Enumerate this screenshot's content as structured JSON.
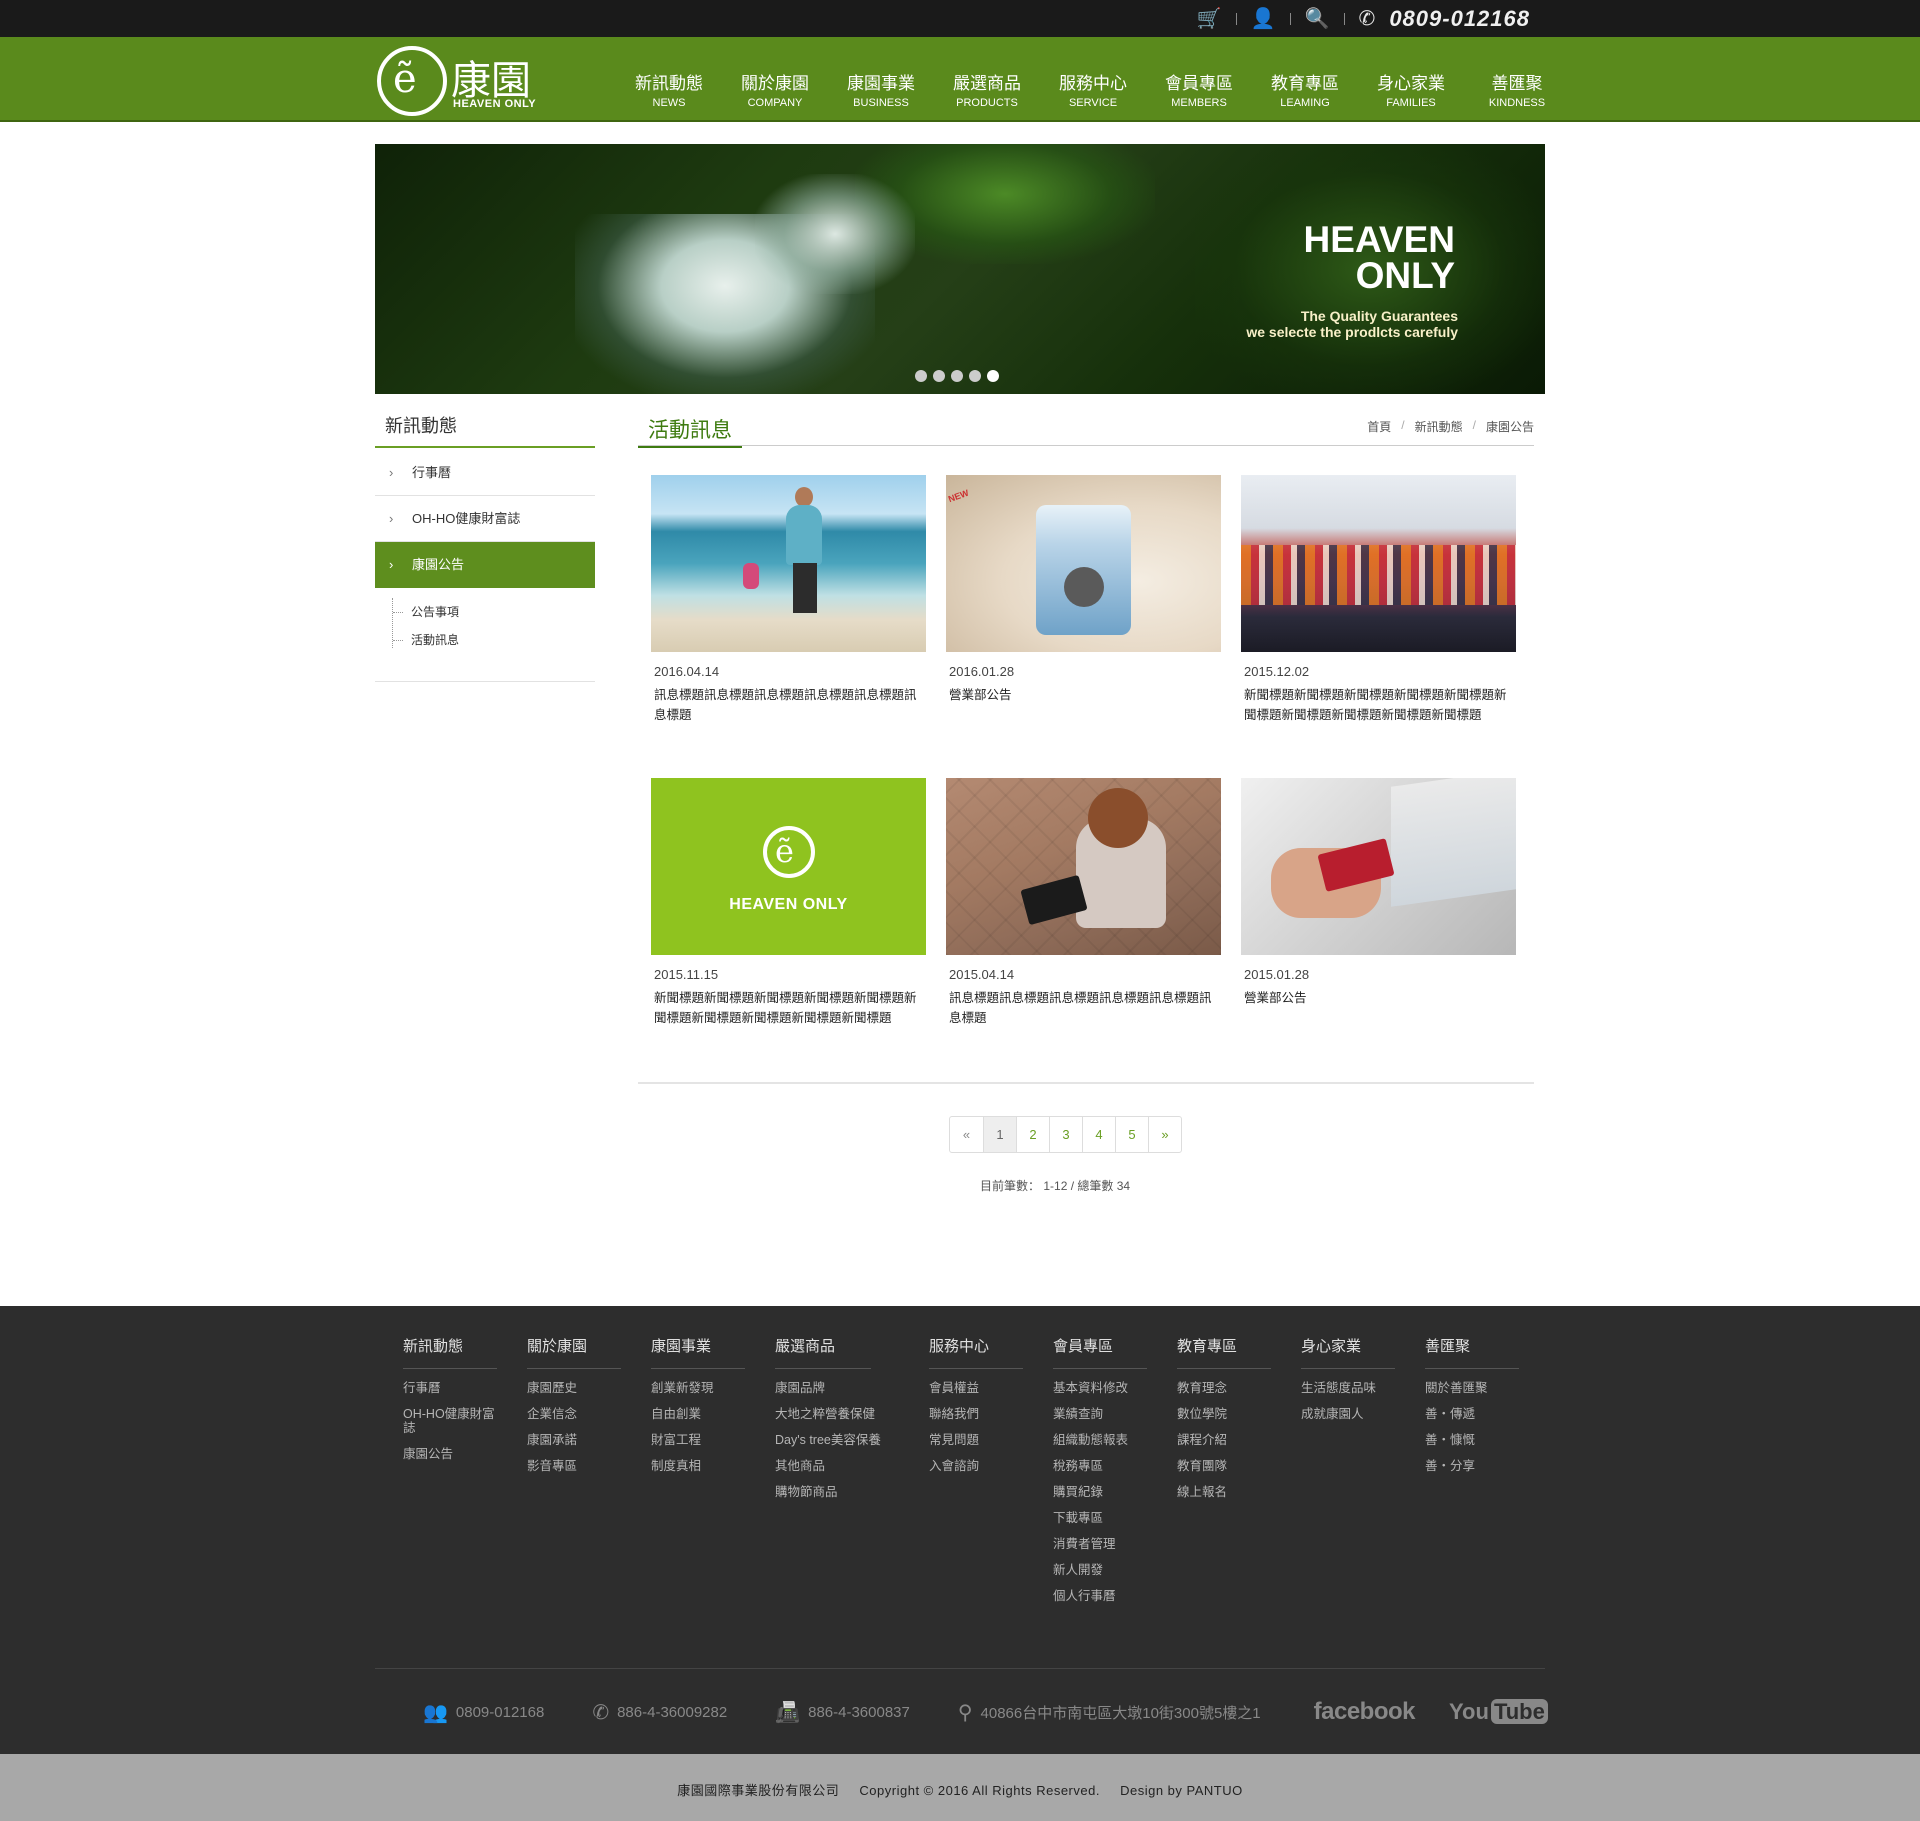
{
  "topbar": {
    "icons": [
      "cart-icon",
      "user-icon",
      "search-icon",
      "phone-icon"
    ],
    "phone": "0809-012168"
  },
  "logo": {
    "cn": "康園",
    "en": "HEAVEN ONLY"
  },
  "nav": [
    {
      "zh": "新訊動態",
      "en": "NEWS"
    },
    {
      "zh": "關於康園",
      "en": "COMPANY"
    },
    {
      "zh": "康園事業",
      "en": "BUSINESS"
    },
    {
      "zh": "嚴選商品",
      "en": "PRODUCTS"
    },
    {
      "zh": "服務中心",
      "en": "SERVICE"
    },
    {
      "zh": "會員專區",
      "en": "MEMBERS"
    },
    {
      "zh": "教育專區",
      "en": "LEAMING"
    },
    {
      "zh": "身心家業",
      "en": "FAMILIES"
    },
    {
      "zh": "善匯聚",
      "en": "KINDNESS"
    }
  ],
  "banner": {
    "title_line1": "HEAVEN",
    "title_line2": "ONLY",
    "sub_line1": "The Quality Guarantees",
    "sub_line2": "we selecte the prodlcts carefuly",
    "slides": 5,
    "active_slide": 5
  },
  "sidebar": {
    "title": "新訊動態",
    "items": [
      {
        "label": "行事曆"
      },
      {
        "label": "OH-HO健康財富誌"
      },
      {
        "label": "康園公告"
      }
    ],
    "sub": [
      {
        "label": "公告事項"
      },
      {
        "label": "活動訊息"
      }
    ]
  },
  "main": {
    "title": "活動訊息",
    "breadcrumb": [
      "首頁",
      "新訊動態",
      "康園公告"
    ],
    "cards": [
      {
        "date": "2016.04.14",
        "title": "訊息標題訊息標題訊息標題訊息標題訊息標題訊息標題"
      },
      {
        "date": "2016.01.28",
        "title": "營業部公告"
      },
      {
        "date": "2015.12.02",
        "title": "新聞標題新聞標題新聞標題新聞標題新聞標題新聞標題新聞標題新聞標題新聞標題新聞標題"
      },
      {
        "date": "2015.11.15",
        "title": "新聞標題新聞標題新聞標題新聞標題新聞標題新聞標題新聞標題新聞標題新聞標題新聞標題"
      },
      {
        "date": "2015.04.14",
        "title": "訊息標題訊息標題訊息標題訊息標題訊息標題訊息標題"
      },
      {
        "date": "2015.01.28",
        "title": "營業部公告"
      }
    ],
    "card_logo_text": "HEAVEN ONLY",
    "pager": {
      "prev": "«",
      "pages": [
        "1",
        "2",
        "3",
        "4",
        "5"
      ],
      "current": "1",
      "next": "»"
    },
    "count_label": "目前筆數：",
    "count_value": "1-12 / 總筆數 34"
  },
  "footer": {
    "columns": [
      {
        "heading": "新訊動態",
        "links": [
          "行事曆",
          "OH-HO健康財富誌",
          "康園公告"
        ]
      },
      {
        "heading": "關於康園",
        "links": [
          "康園歷史",
          "企業信念",
          "康園承諾",
          "影音專區"
        ]
      },
      {
        "heading": "康園事業",
        "links": [
          "創業新發現",
          "自由創業",
          "財富工程",
          "制度真相"
        ]
      },
      {
        "heading": "嚴選商品",
        "links": [
          "康園品牌",
          "大地之粹營養保健",
          "Day's tree美容保養",
          "其他商品",
          "購物節商品"
        ]
      },
      {
        "heading": "服務中心",
        "links": [
          "會員權益",
          "聯絡我們",
          "常見問題",
          "入會諮詢"
        ]
      },
      {
        "heading": "會員專區",
        "links": [
          "基本資料修改",
          "業績查詢",
          "組織動態報表",
          "稅務專區",
          "購買紀錄",
          "下載專區",
          "消費者管理",
          "新人開發",
          "個人行事曆"
        ]
      },
      {
        "heading": "教育專區",
        "links": [
          "教育理念",
          "數位學院",
          "課程介紹",
          "教育團隊",
          "線上報名"
        ]
      },
      {
        "heading": "身心家業",
        "links": [
          "生活態度品味",
          "成就康園人"
        ]
      },
      {
        "heading": "善匯聚",
        "links": [
          "關於善匯聚",
          "善・傳遞",
          "善・慷慨",
          "善・分享"
        ]
      }
    ],
    "info": {
      "phone": "0809-012168",
      "tel": "886-4-36009282",
      "fax": "886-4-3600837",
      "address": "40866台中市南屯區大墩10街300號5樓之1",
      "facebook": "facebook",
      "youtube_you": "You",
      "youtube_tube": "Tube"
    },
    "copyright": {
      "company": "康園國際事業股份有限公司",
      "rights": "Copyright © 2016 All Rights Reserved.",
      "design": "Design by PANTUO"
    }
  },
  "colors": {
    "nav_green": "#5a8a1c",
    "accent_green": "#6a9f24",
    "footer_bg": "#2d2d2d",
    "copyright_bg": "#a8a8a8"
  }
}
